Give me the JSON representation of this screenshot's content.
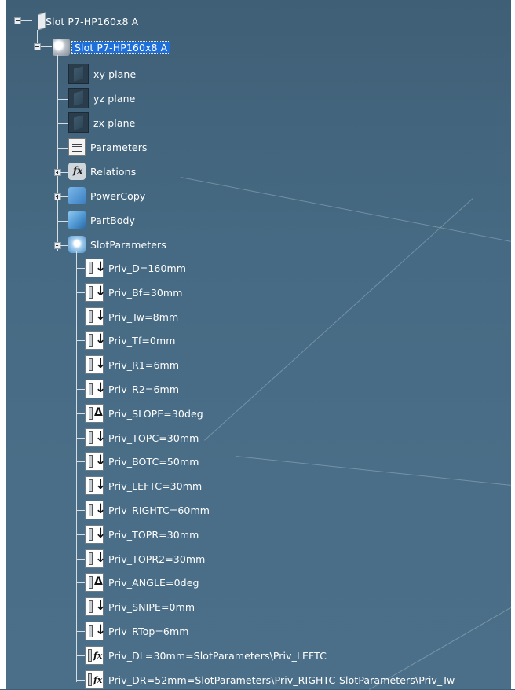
{
  "tree": {
    "root": {
      "label": "Slot P7-HP160x8 A",
      "icon": "document-icon"
    },
    "part": {
      "label": "Slot P7-HP160x8 A",
      "icon": "part-icon",
      "selected": true
    },
    "children": [
      {
        "label": "xy plane",
        "icon": "plane-icon"
      },
      {
        "label": "yz plane",
        "icon": "plane-icon"
      },
      {
        "label": "zx plane",
        "icon": "plane-icon"
      },
      {
        "label": "Parameters",
        "icon": "parameters-icon"
      },
      {
        "label": "Relations",
        "icon": "relations-icon",
        "expandable": true
      },
      {
        "label": "PowerCopy",
        "icon": "powercopy-icon",
        "expandable": true
      },
      {
        "label": "PartBody",
        "icon": "partbody-icon"
      },
      {
        "label": "SlotParameters",
        "icon": "parameter-set-icon",
        "expanded": true
      }
    ],
    "slot_parameters": [
      {
        "label": "Priv_D=160mm",
        "icon": "length-param-icon"
      },
      {
        "label": "Priv_Bf=30mm",
        "icon": "length-param-icon"
      },
      {
        "label": "Priv_Tw=8mm",
        "icon": "length-param-icon"
      },
      {
        "label": "Priv_Tf=0mm",
        "icon": "length-param-icon"
      },
      {
        "label": "Priv_R1=6mm",
        "icon": "length-param-icon"
      },
      {
        "label": "Priv_R2=6mm",
        "icon": "length-param-icon"
      },
      {
        "label": "Priv_SLOPE=30deg",
        "icon": "angle-param-icon"
      },
      {
        "label": "Priv_TOPC=30mm",
        "icon": "length-param-icon"
      },
      {
        "label": "Priv_BOTC=50mm",
        "icon": "length-param-icon"
      },
      {
        "label": "Priv_LEFTC=30mm",
        "icon": "length-param-icon"
      },
      {
        "label": "Priv_RIGHTC=60mm",
        "icon": "length-param-icon"
      },
      {
        "label": "Priv_TOPR=30mm",
        "icon": "length-param-icon"
      },
      {
        "label": "Priv_TOPR2=30mm",
        "icon": "length-param-icon"
      },
      {
        "label": "Priv_ANGLE=0deg",
        "icon": "angle-param-icon"
      },
      {
        "label": "Priv_SNIPE=0mm",
        "icon": "length-param-icon"
      },
      {
        "label": "Priv_RTop=6mm",
        "icon": "length-param-icon"
      },
      {
        "label": "Priv_DL=30mm=SlotParameters\\Priv_LEFTC",
        "icon": "formula-param-icon"
      },
      {
        "label": "Priv_DR=52mm=SlotParameters\\Priv_RIGHTC-SlotParameters\\Priv_Tw",
        "icon": "formula-param-icon"
      }
    ]
  },
  "colors": {
    "background": "#466a83",
    "selection": "#1f6fd8",
    "text": "#ffffff",
    "tree_lines": "#d7dde2"
  }
}
